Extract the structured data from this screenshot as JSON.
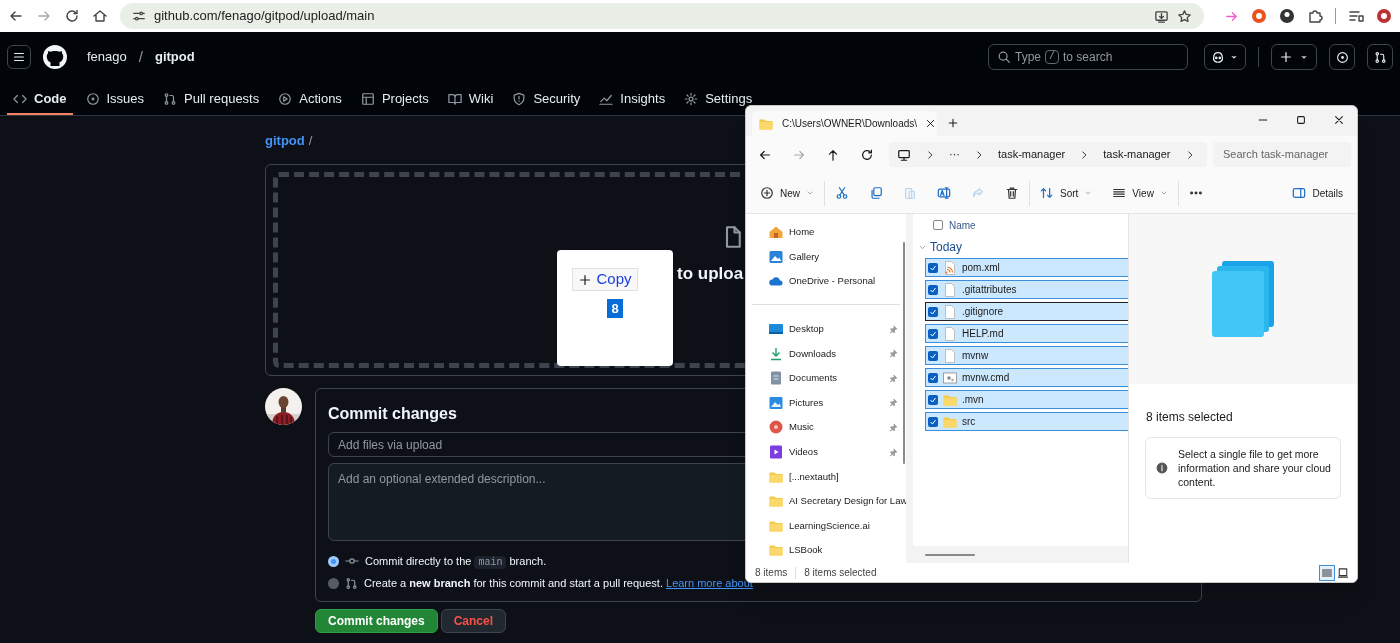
{
  "browser": {
    "url": "github.com/fenago/gitpod/upload/main"
  },
  "repo": {
    "owner": "fenago",
    "separator": "/",
    "name": "gitpod"
  },
  "search": {
    "before": "Type",
    "key": "/",
    "after": "to search"
  },
  "tabs": [
    {
      "label": "Code",
      "kind": "code",
      "selected": true
    },
    {
      "label": "Issues",
      "kind": "issues",
      "selected": false
    },
    {
      "label": "Pull requests",
      "kind": "pr",
      "selected": false
    },
    {
      "label": "Actions",
      "kind": "actions",
      "selected": false
    },
    {
      "label": "Projects",
      "kind": "projects",
      "selected": false
    },
    {
      "label": "Wiki",
      "kind": "wiki",
      "selected": false
    },
    {
      "label": "Security",
      "kind": "security",
      "selected": false
    },
    {
      "label": "Insights",
      "kind": "insights",
      "selected": false
    },
    {
      "label": "Settings",
      "kind": "settings",
      "selected": false
    }
  ],
  "breadcrumb": {
    "repo": "gitpod",
    "separator": "/"
  },
  "drop_zone": {
    "text": "to uploa"
  },
  "drag_popup": {
    "action": "Copy",
    "count": "8"
  },
  "commit": {
    "title": "Commit changes",
    "summary_placeholder": "Add files via upload",
    "description_placeholder": "Add an optional extended description...",
    "options": [
      {
        "kind": "direct",
        "before": "Commit directly to the",
        "code": "main",
        "after": "branch.",
        "selected": true
      },
      {
        "kind": "branch",
        "text": "Create a **new branch** for this commit and start a pull request.",
        "link": "Learn more about",
        "selected": false
      }
    ],
    "buttons": [
      {
        "kind": "primary",
        "label": "Commit changes"
      },
      {
        "kind": "cancel",
        "label": "Cancel"
      }
    ]
  },
  "explorer": {
    "tab_title": "C:\\Users\\OWNER\\Downloads\\",
    "crumbs": [
      "···",
      "task-manager",
      "task-manager"
    ],
    "search_placeholder": "Search task-manager",
    "toolbar_groups": [
      [
        {
          "kind": "new",
          "label": "New",
          "disabled": false
        }
      ],
      [
        {
          "kind": "cut",
          "disabled": false
        },
        {
          "kind": "copy",
          "disabled": false
        },
        {
          "kind": "paste",
          "disabled": true
        },
        {
          "kind": "rename",
          "disabled": false
        },
        {
          "kind": "share",
          "disabled": true
        },
        {
          "kind": "delete",
          "disabled": false
        }
      ],
      [
        {
          "kind": "sort",
          "label": "Sort",
          "disabled": false
        },
        {
          "kind": "view",
          "label": "View",
          "disabled": false
        }
      ],
      [
        {
          "kind": "more",
          "disabled": false
        }
      ]
    ],
    "details_button": "Details",
    "nav_groups": [
      [
        {
          "label": "Home",
          "kind": "home",
          "pinned": false
        },
        {
          "label": "Gallery",
          "kind": "gallery",
          "pinned": false
        },
        {
          "label": "OneDrive - Personal",
          "kind": "cloud",
          "pinned": false
        }
      ],
      [
        {
          "label": "Desktop",
          "kind": "desktop",
          "pinned": true
        },
        {
          "label": "Downloads",
          "kind": "downloads",
          "pinned": true
        },
        {
          "label": "Documents",
          "kind": "documents",
          "pinned": true
        },
        {
          "label": "Pictures",
          "kind": "pictures",
          "pinned": true
        },
        {
          "label": "Music",
          "kind": "music",
          "pinned": true
        },
        {
          "label": "Videos",
          "kind": "videos",
          "pinned": true
        },
        {
          "label": "[...nextauth]",
          "kind": "folder",
          "pinned": false
        },
        {
          "label": "AI Secretary Design for Law",
          "kind": "folder",
          "pinned": false
        },
        {
          "label": "LearningScience.ai",
          "kind": "folder",
          "pinned": false
        },
        {
          "label": "LSBook",
          "kind": "folder",
          "pinned": false
        }
      ]
    ],
    "column": {
      "label": "Name",
      "checked": false
    },
    "group": {
      "label": "Today",
      "expanded": true
    },
    "files": [
      {
        "name": "pom.xml",
        "kind": "xml",
        "checked": true,
        "focused": false
      },
      {
        "name": ".gitattributes",
        "kind": "file",
        "checked": true,
        "focused": false
      },
      {
        "name": ".gitignore",
        "kind": "file",
        "checked": true,
        "focused": true
      },
      {
        "name": "HELP.md",
        "kind": "file",
        "checked": true,
        "focused": false
      },
      {
        "name": "mvnw",
        "kind": "file",
        "checked": true,
        "focused": false
      },
      {
        "name": "mvnw.cmd",
        "kind": "cmd",
        "checked": true,
        "focused": false
      },
      {
        "name": ".mvn",
        "kind": "folder",
        "checked": true,
        "focused": false
      },
      {
        "name": "src",
        "kind": "folder",
        "checked": true,
        "focused": false
      }
    ],
    "details": {
      "heading": "8 items selected",
      "info": "Select a single file to get more information and share your cloud content."
    },
    "status": [
      "8 items",
      "8 items selected"
    ],
    "views": [
      {
        "kind": "details",
        "selected": true
      },
      {
        "kind": "tiles",
        "selected": false
      }
    ]
  }
}
